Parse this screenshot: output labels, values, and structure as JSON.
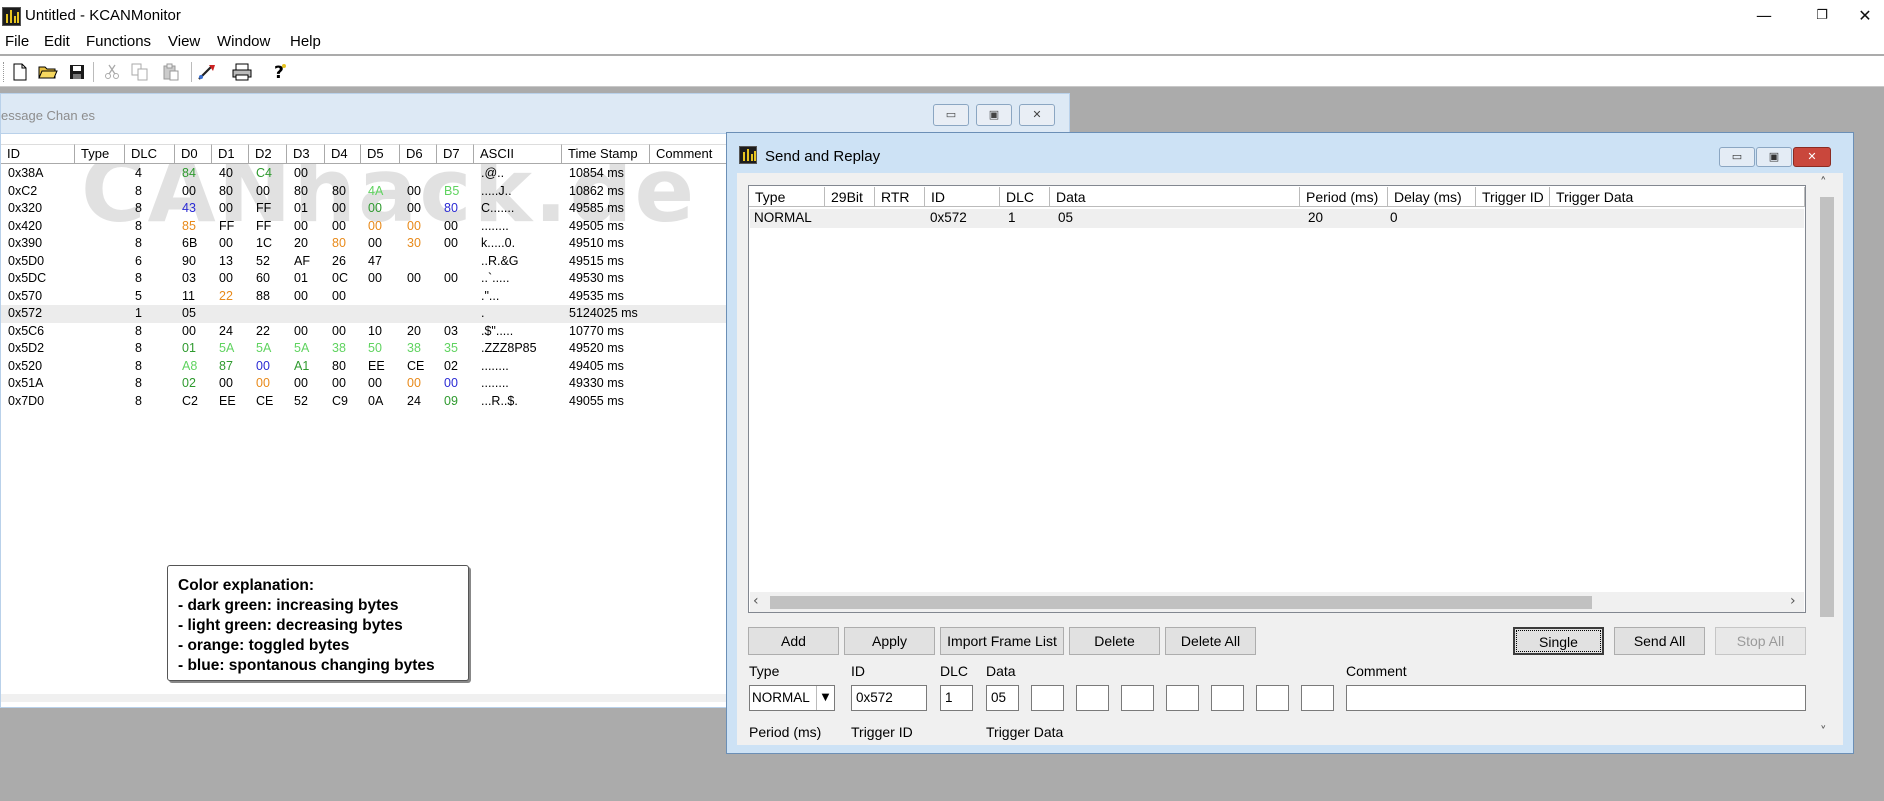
{
  "app": {
    "title": "Untitled - KCANMonitor",
    "controls": {
      "minimize": "—",
      "restore": "❐",
      "close": "✕"
    }
  },
  "menu": [
    "File",
    "Edit",
    "Functions",
    "View",
    "Window",
    "Help"
  ],
  "toolbar_icons": [
    "new-file-icon",
    "open-folder-icon",
    "save-icon",
    "cut-icon",
    "copy-icon",
    "paste-icon",
    "connect-icon",
    "print-icon",
    "help-icon"
  ],
  "message_window": {
    "title": "essage Chan  es",
    "watermark": "CANhack.de",
    "columns": [
      "ID",
      "Type",
      "DLC",
      "D0",
      "D1",
      "D2",
      "D3",
      "D4",
      "D5",
      "D6",
      "D7",
      "ASCII",
      "Time Stamp",
      "Comment"
    ],
    "rows": [
      [
        "0x38A",
        "",
        "4",
        "84",
        "40",
        "C4",
        "00",
        "",
        "",
        "",
        "",
        ".@..",
        "10854 ms"
      ],
      [
        "0xC2",
        "",
        "8",
        "00",
        "80",
        "00",
        "80",
        "80",
        "4A",
        "00",
        "B5",
        ".....J..",
        "10862 ms"
      ],
      [
        "0x320",
        "",
        "8",
        "43",
        "00",
        "FF",
        "01",
        "00",
        "00",
        "00",
        "80",
        "C.......",
        "49585 ms"
      ],
      [
        "0x420",
        "",
        "8",
        "85",
        "FF",
        "FF",
        "00",
        "00",
        "00",
        "00",
        "00",
        "........",
        "49505 ms"
      ],
      [
        "0x390",
        "",
        "8",
        "6B",
        "00",
        "1C",
        "20",
        "80",
        "00",
        "30",
        "00",
        "k.....0.",
        "49510 ms"
      ],
      [
        "0x5D0",
        "",
        "6",
        "90",
        "13",
        "52",
        "AF",
        "26",
        "47",
        "",
        "",
        "..R.&G",
        "49515 ms"
      ],
      [
        "0x5DC",
        "",
        "8",
        "03",
        "00",
        "60",
        "01",
        "0C",
        "00",
        "00",
        "00",
        "..`.....",
        "49530 ms"
      ],
      [
        "0x570",
        "",
        "5",
        "11",
        "22",
        "88",
        "00",
        "00",
        "",
        "",
        "",
        ".\"...",
        "49535 ms"
      ],
      [
        "0x572",
        "",
        "1",
        "05",
        "",
        "",
        "",
        "",
        "",
        "",
        "",
        ".",
        "5124025 ms"
      ],
      [
        "0x5C6",
        "",
        "8",
        "00",
        "24",
        "22",
        "00",
        "00",
        "10",
        "20",
        "03",
        ".$\".....",
        "10770 ms"
      ],
      [
        "0x5D2",
        "",
        "8",
        "01",
        "5A",
        "5A",
        "5A",
        "38",
        "50",
        "38",
        "35",
        ".ZZZ8P85",
        "49520 ms"
      ],
      [
        "0x520",
        "",
        "8",
        "A8",
        "87",
        "00",
        "A1",
        "80",
        "EE",
        "CE",
        "02",
        "........",
        "49405 ms"
      ],
      [
        "0x51A",
        "",
        "8",
        "02",
        "00",
        "00",
        "00",
        "00",
        "00",
        "00",
        "00",
        "........",
        "49330 ms"
      ],
      [
        "0x7D0",
        "",
        "8",
        "C2",
        "EE",
        "CE",
        "52",
        "C9",
        "0A",
        "24",
        "09",
        "...R..$.",
        "49055 ms"
      ]
    ],
    "cell_colors": {
      "0": {
        "3": "green",
        "5": "green"
      },
      "1": {
        "8": "lightgreen",
        "10": "lightgreen"
      },
      "2": {
        "3": "blue",
        "8": "green",
        "10": "blue"
      },
      "3": {
        "3": "orange",
        "8": "orange",
        "9": "orange"
      },
      "4": {
        "7": "orange",
        "9": "orange"
      },
      "7": {
        "4": "orange"
      },
      "10": {
        "3": "green",
        "4": "lightgreen",
        "5": "lightgreen",
        "6": "lightgreen",
        "7": "lightgreen",
        "8": "lightgreen",
        "9": "lightgreen",
        "10": "lightgreen"
      },
      "11": {
        "3": "lightgreen",
        "4": "green",
        "5": "blue",
        "6": "green"
      },
      "12": {
        "3": "green",
        "5": "orange",
        "9": "orange",
        "10": "blue"
      },
      "13": {
        "10": "green"
      }
    },
    "selected_row": 8,
    "color_explanation": [
      "Color explanation:",
      " - dark green: increasing bytes",
      " - light green: decreasing bytes",
      " - orange: toggled bytes",
      " - blue: spontanous changing bytes"
    ]
  },
  "colors": {
    "green": "#2e9a2e",
    "lightgreen": "#5fd35f",
    "orange": "#e88a1a",
    "blue": "#2a2ad4"
  },
  "send_window": {
    "title": "Send and Replay",
    "columns": [
      "Type",
      "29Bit",
      "RTR",
      "ID",
      "DLC",
      "Data",
      "Period (ms)",
      "Delay (ms)",
      "Trigger ID",
      "Trigger Data"
    ],
    "rows": [
      [
        "NORMAL",
        "",
        "",
        "0x572",
        "1",
        "05",
        "20",
        "0",
        "",
        ""
      ]
    ],
    "buttons": {
      "add": "Add",
      "apply": "Apply",
      "import": "Import Frame List",
      "delete": "Delete",
      "delete_all": "Delete All",
      "single": "Single",
      "send_all": "Send All",
      "stop_all": "Stop All"
    },
    "form": {
      "type_label": "Type",
      "id_label": "ID",
      "dlc_label": "DLC",
      "data_label": "Data",
      "comment_label": "Comment",
      "type_value": "NORMAL",
      "id_value": "0x572",
      "dlc_value": "1",
      "data_values": [
        "05",
        "",
        "",
        "",
        "",
        "",
        "",
        ""
      ],
      "comment_value": "",
      "period_label": "Period (ms)",
      "trigger_id_label": "Trigger ID",
      "trigger_data_label": "Trigger Data"
    }
  }
}
